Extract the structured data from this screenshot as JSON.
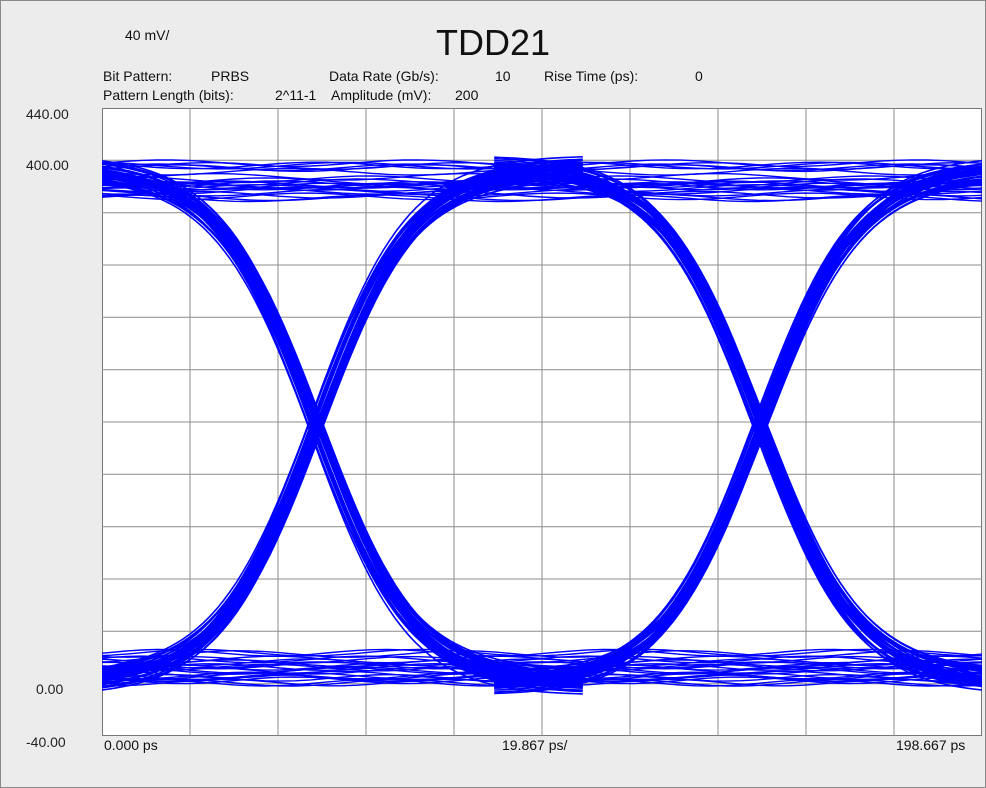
{
  "chart_data": {
    "type": "line",
    "title": "TDD21",
    "y_scale_label": "40 mV/",
    "x_scale_label": "19.867 ps/",
    "x_start_label": "0.000 ps",
    "x_end_label": "198.667 ps",
    "ylim": [
      -40,
      440
    ],
    "xlim": [
      0,
      198.667
    ],
    "y_tick_labels": [
      {
        "value": 440,
        "label": "440.00"
      },
      {
        "value": 400,
        "label": "400.00"
      },
      {
        "value": 0,
        "label": "0.00"
      },
      {
        "value": -40,
        "label": "-40.00"
      }
    ],
    "grid": true,
    "grid_divisions_x": 10,
    "grid_divisions_y": 12,
    "trace_color": "#0000ff",
    "eye": {
      "high_level_mv": 395,
      "low_level_mv": 0,
      "eye_top_inner_mv": 370,
      "eye_bottom_inner_mv": 25,
      "crossing_level_mv": 200,
      "crossings_ps": [
        48.4,
        148.7
      ],
      "unit_interval_ps": 100.3
    },
    "params": {
      "bit_pattern_label": "Bit Pattern:",
      "bit_pattern": "PRBS",
      "pattern_length_label": "Pattern Length (bits):",
      "pattern_length": "2^11-1",
      "data_rate_label": "Data Rate (Gb/s):",
      "data_rate": "10",
      "amplitude_label": "Amplitude (mV):",
      "amplitude": "200",
      "rise_time_label": "Rise Time (ps):",
      "rise_time": "0"
    }
  }
}
